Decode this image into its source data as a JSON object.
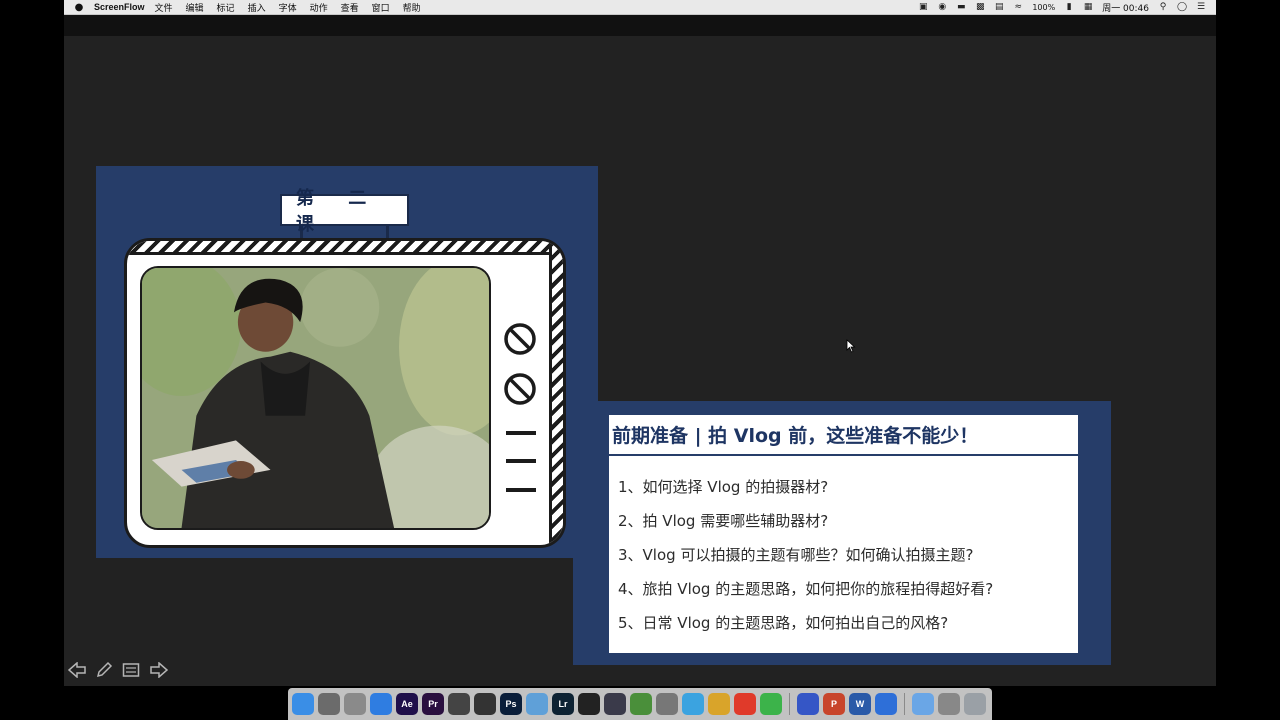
{
  "menubar": {
    "apple": "",
    "app_name": "ScreenFlow",
    "menus": [
      "文件",
      "编辑",
      "标记",
      "插入",
      "字体",
      "动作",
      "查看",
      "窗口",
      "帮助"
    ],
    "battery": "100%",
    "clock": "周一 00:46"
  },
  "slide": {
    "lesson_tag": "第 二 课",
    "title": "前期准备 | 拍 Vlog 前，这些准备不能少！",
    "items": [
      "1、如何选择 Vlog 的拍摄器材?",
      "2、拍 Vlog 需要哪些辅助器材?",
      "3、Vlog 可以拍摄的主题有哪些？如何确认拍摄主题?",
      "4、旅拍 Vlog 的主题思路，如何把你的旅程拍得超好看?",
      "5、日常 Vlog 的主题思路，如何拍出自己的风格?"
    ],
    "colors": {
      "panel": "#263d69",
      "title": "#1e3563",
      "stage": "#222222"
    }
  },
  "nav_controls": [
    "prev-arrow-icon",
    "pen-icon",
    "slides-icon",
    "next-arrow-icon"
  ],
  "dock": {
    "apps": [
      {
        "icon": "finder-icon",
        "label": "",
        "color": "#3a8ee6"
      },
      {
        "icon": "launchpad-icon",
        "label": "",
        "color": "#6b6b6b"
      },
      {
        "icon": "system-preferences-icon",
        "label": "",
        "color": "#8a8a8a"
      },
      {
        "icon": "safari-icon",
        "label": "",
        "color": "#2f7de1"
      },
      {
        "icon": "after-effects-icon",
        "label": "Ae",
        "color": "#1f0f4a"
      },
      {
        "icon": "premiere-icon",
        "label": "Pr",
        "color": "#2a0f3f"
      },
      {
        "icon": "final-cut-icon",
        "label": "",
        "color": "#444"
      },
      {
        "icon": "davinci-icon",
        "label": "",
        "color": "#333"
      },
      {
        "icon": "photoshop-icon",
        "label": "Ps",
        "color": "#0a1e3a"
      },
      {
        "icon": "info-icon",
        "label": "",
        "color": "#5fa0d8"
      },
      {
        "icon": "lightroom-icon",
        "label": "Lr",
        "color": "#0d2233"
      },
      {
        "icon": "qq-icon",
        "label": "",
        "color": "#222"
      },
      {
        "icon": "vpn-icon",
        "label": "",
        "color": "#3a3a4a"
      },
      {
        "icon": "gif-icon",
        "label": "",
        "color": "#4a8f3a"
      },
      {
        "icon": "screenshot-icon",
        "label": "",
        "color": "#777"
      },
      {
        "icon": "search-app-icon",
        "label": "",
        "color": "#3ba3e0"
      },
      {
        "icon": "chrome-icon",
        "label": "",
        "color": "#d9a42a"
      },
      {
        "icon": "weibo-icon",
        "label": "",
        "color": "#e03a2a"
      },
      {
        "icon": "wechat-icon",
        "label": "",
        "color": "#3cb34a"
      },
      {
        "icon": "screenflow-icon",
        "label": "",
        "color": "#3556c6"
      },
      {
        "icon": "powerpoint-icon",
        "label": "P",
        "color": "#c8452b"
      },
      {
        "icon": "word-icon",
        "label": "W",
        "color": "#2a5aa8"
      },
      {
        "icon": "baidu-netdisk-icon",
        "label": "",
        "color": "#2e6fd8"
      },
      {
        "icon": "folder-icon",
        "label": "",
        "color": "#6aa6e6"
      },
      {
        "icon": "preview-icon",
        "label": "",
        "color": "#888"
      },
      {
        "icon": "trash-icon",
        "label": "",
        "color": "#9aa0a6"
      }
    ]
  }
}
